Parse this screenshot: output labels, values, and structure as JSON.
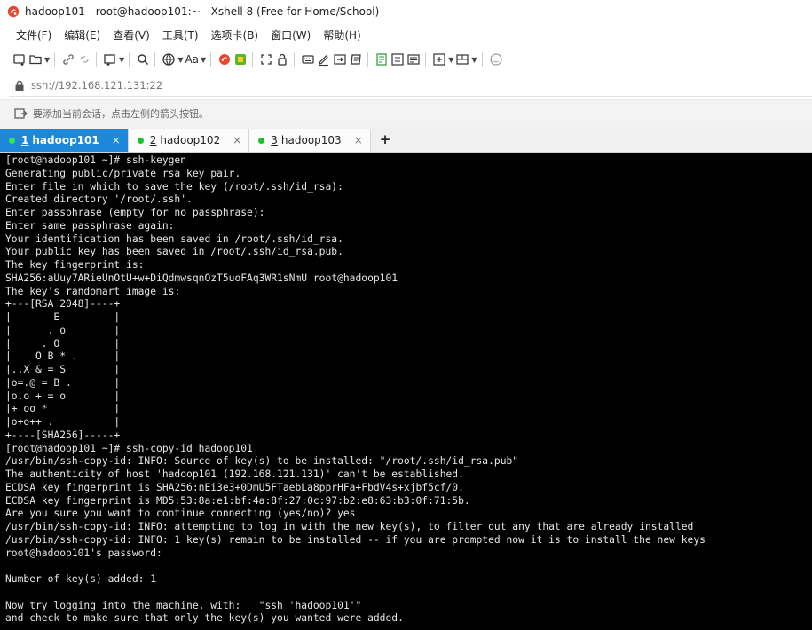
{
  "window": {
    "title": "hadoop101 - root@hadoop101:~ - Xshell 8 (Free for Home/School)"
  },
  "menu": [
    {
      "label": "文件(F)"
    },
    {
      "label": "编辑(E)"
    },
    {
      "label": "查看(V)"
    },
    {
      "label": "工具(T)"
    },
    {
      "label": "选项卡(B)"
    },
    {
      "label": "窗口(W)"
    },
    {
      "label": "帮助(H)"
    }
  ],
  "toolbar": {
    "font_label": "Aa"
  },
  "address": {
    "value": "ssh://192.168.121.131:22"
  },
  "hint": {
    "text": "要添加当前会话，点击左侧的箭头按钮。"
  },
  "tabs": [
    {
      "number": "1",
      "label": "hadoop101",
      "active": true
    },
    {
      "number": "2",
      "label": "hadoop102",
      "active": false
    },
    {
      "number": "3",
      "label": "hadoop103",
      "active": false
    }
  ],
  "tab_close_glyph": "×",
  "tab_add_glyph": "+",
  "colors": {
    "active_tab": "#1e88d8",
    "status_dot": "#19c12a",
    "terminal_bg": "#000000",
    "terminal_fg": "#e6e6e6"
  },
  "terminal": {
    "lines": [
      "[root@hadoop101 ~]# ssh-keygen",
      "Generating public/private rsa key pair.",
      "Enter file in which to save the key (/root/.ssh/id_rsa):",
      "Created directory '/root/.ssh'.",
      "Enter passphrase (empty for no passphrase):",
      "Enter same passphrase again:",
      "Your identification has been saved in /root/.ssh/id_rsa.",
      "Your public key has been saved in /root/.ssh/id_rsa.pub.",
      "The key fingerprint is:",
      "SHA256:aUuy7ARieUnOtU+w+DiQdmwsqnOzT5uoFAq3WR1sNmU root@hadoop101",
      "The key's randomart image is:",
      "+---[RSA 2048]----+",
      "|       E         |",
      "|      . o        |",
      "|     . O         |",
      "|    O B * .      |",
      "|..X & = S        |",
      "|o=.@ = B .       |",
      "|o.o + = o        |",
      "|+ oo *           |",
      "|o+o++ .          |",
      "+----[SHA256]-----+",
      "[root@hadoop101 ~]# ssh-copy-id hadoop101",
      "/usr/bin/ssh-copy-id: INFO: Source of key(s) to be installed: \"/root/.ssh/id_rsa.pub\"",
      "The authenticity of host 'hadoop101 (192.168.121.131)' can't be established.",
      "ECDSA key fingerprint is SHA256:nEi3e3+0DmU5FTaebLa8pprHFa+FbdV4s+xjbf5cf/0.",
      "ECDSA key fingerprint is MD5:53:8a:e1:bf:4a:8f:27:0c:97:b2:e8:63:b3:0f:71:5b.",
      "Are you sure you want to continue connecting (yes/no)? yes",
      "/usr/bin/ssh-copy-id: INFO: attempting to log in with the new key(s), to filter out any that are already installed",
      "/usr/bin/ssh-copy-id: INFO: 1 key(s) remain to be installed -- if you are prompted now it is to install the new keys",
      "root@hadoop101's password:",
      "",
      "Number of key(s) added: 1",
      "",
      "Now try logging into the machine, with:   \"ssh 'hadoop101'\"",
      "and check to make sure that only the key(s) you wanted were added."
    ]
  }
}
